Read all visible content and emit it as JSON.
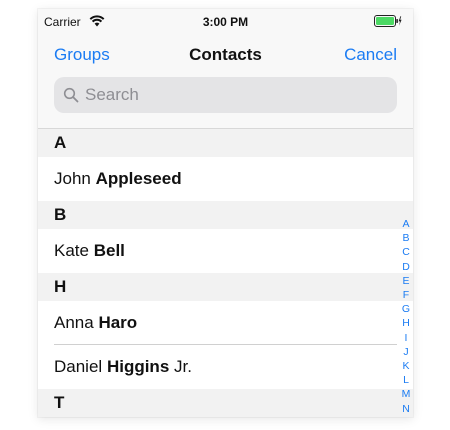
{
  "status": {
    "carrier": "Carrier",
    "time": "3:00 PM"
  },
  "nav": {
    "left": "Groups",
    "title": "Contacts",
    "right": "Cancel"
  },
  "search": {
    "placeholder": "Search",
    "value": ""
  },
  "sections": [
    {
      "header": "A",
      "rows": [
        {
          "first": "John",
          "last": "Appleseed",
          "suffix": ""
        }
      ]
    },
    {
      "header": "B",
      "rows": [
        {
          "first": "Kate",
          "last": "Bell",
          "suffix": ""
        }
      ]
    },
    {
      "header": "H",
      "rows": [
        {
          "first": "Anna",
          "last": "Haro",
          "suffix": ""
        },
        {
          "first": "Daniel",
          "last": "Higgins",
          "suffix": "Jr."
        }
      ]
    },
    {
      "header": "T",
      "rows": []
    }
  ],
  "index": [
    "A",
    "B",
    "C",
    "D",
    "E",
    "F",
    "G",
    "H",
    "I",
    "J",
    "K",
    "L",
    "M",
    "N"
  ],
  "colors": {
    "accent": "#1b7cf3",
    "battery": "#4cd964"
  },
  "icons": {
    "wifi": "wifi-icon",
    "battery": "battery-icon",
    "charging": "charging-bolt-icon",
    "search": "search-icon"
  }
}
